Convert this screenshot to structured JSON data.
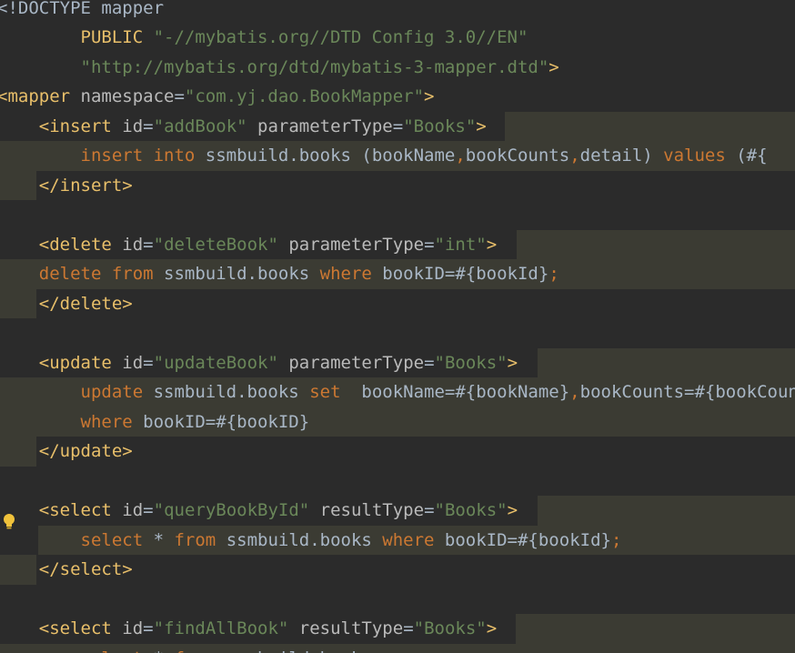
{
  "editor": {
    "lines": [
      {
        "tokens": [
          {
            "t": "plain",
            "v": "<!DOCTYPE mapper"
          }
        ]
      },
      {
        "tokens": [
          {
            "t": "plain",
            "v": "        "
          },
          {
            "t": "tag",
            "v": "PUBLIC "
          },
          {
            "t": "str",
            "v": "\"-//mybatis.org//DTD Config 3.0//EN\""
          }
        ]
      },
      {
        "tokens": [
          {
            "t": "plain",
            "v": "        "
          },
          {
            "t": "str",
            "v": "\"http://mybatis.org/dtd/mybatis-3-mapper.dtd\""
          },
          {
            "t": "tag",
            "v": ">"
          }
        ]
      },
      {
        "tokens": [
          {
            "t": "tag",
            "v": "<mapper "
          },
          {
            "t": "attr",
            "v": "namespace"
          },
          {
            "t": "eq",
            "v": "="
          },
          {
            "t": "str",
            "v": "\"com.yj.dao.BookMapper\""
          },
          {
            "t": "tag",
            "v": ">"
          }
        ]
      },
      {
        "tokens": [
          {
            "t": "plain",
            "v": "    "
          },
          {
            "t": "tag",
            "v": "<insert "
          },
          {
            "t": "attr",
            "v": "id"
          },
          {
            "t": "eq",
            "v": "="
          },
          {
            "t": "str",
            "v": "\"addBook\""
          },
          {
            "t": "plain",
            "v": " "
          },
          {
            "t": "attr",
            "v": "parameterType"
          },
          {
            "t": "eq",
            "v": "="
          },
          {
            "t": "str",
            "v": "\"Books\""
          },
          {
            "t": "tag",
            "v": ">"
          }
        ]
      },
      {
        "tokens": [
          {
            "t": "plain",
            "v": "        "
          },
          {
            "t": "kw",
            "v": "insert into "
          },
          {
            "t": "plain",
            "v": "ssmbuild.books (bookName"
          },
          {
            "t": "punct",
            "v": ","
          },
          {
            "t": "plain",
            "v": "bookCounts"
          },
          {
            "t": "punct",
            "v": ","
          },
          {
            "t": "plain",
            "v": "detail) "
          },
          {
            "t": "kw",
            "v": "values "
          },
          {
            "t": "plain",
            "v": "(#{"
          }
        ]
      },
      {
        "tokens": [
          {
            "t": "plain",
            "v": "    "
          },
          {
            "t": "tag",
            "v": "</insert>"
          }
        ]
      },
      {
        "tokens": []
      },
      {
        "tokens": [
          {
            "t": "plain",
            "v": "    "
          },
          {
            "t": "tag",
            "v": "<delete "
          },
          {
            "t": "attr",
            "v": "id"
          },
          {
            "t": "eq",
            "v": "="
          },
          {
            "t": "str",
            "v": "\"deleteBook\""
          },
          {
            "t": "plain",
            "v": " "
          },
          {
            "t": "attr",
            "v": "parameterType"
          },
          {
            "t": "eq",
            "v": "="
          },
          {
            "t": "str",
            "v": "\"int\""
          },
          {
            "t": "tag",
            "v": ">"
          }
        ]
      },
      {
        "tokens": [
          {
            "t": "plain",
            "v": "    "
          },
          {
            "t": "kw",
            "v": "delete from "
          },
          {
            "t": "plain",
            "v": "ssmbuild.books "
          },
          {
            "t": "kw",
            "v": "where "
          },
          {
            "t": "plain",
            "v": "bookID=#{bookId}"
          },
          {
            "t": "punct",
            "v": ";"
          }
        ]
      },
      {
        "tokens": [
          {
            "t": "plain",
            "v": "    "
          },
          {
            "t": "tag",
            "v": "</delete>"
          }
        ]
      },
      {
        "tokens": []
      },
      {
        "tokens": [
          {
            "t": "plain",
            "v": "    "
          },
          {
            "t": "tag",
            "v": "<update "
          },
          {
            "t": "attr",
            "v": "id"
          },
          {
            "t": "eq",
            "v": "="
          },
          {
            "t": "str",
            "v": "\"updateBook\""
          },
          {
            "t": "plain",
            "v": " "
          },
          {
            "t": "attr",
            "v": "parameterType"
          },
          {
            "t": "eq",
            "v": "="
          },
          {
            "t": "str",
            "v": "\"Books\""
          },
          {
            "t": "tag",
            "v": ">"
          }
        ]
      },
      {
        "tokens": [
          {
            "t": "plain",
            "v": "        "
          },
          {
            "t": "kw",
            "v": "update "
          },
          {
            "t": "plain",
            "v": "ssmbuild.books "
          },
          {
            "t": "kw",
            "v": "set  "
          },
          {
            "t": "plain",
            "v": "bookName=#{bookName}"
          },
          {
            "t": "punct",
            "v": ","
          },
          {
            "t": "plain",
            "v": "bookCounts=#{bookCounts}"
          }
        ]
      },
      {
        "tokens": [
          {
            "t": "plain",
            "v": "        "
          },
          {
            "t": "kw",
            "v": "where "
          },
          {
            "t": "plain",
            "v": "bookID=#{bookID}"
          }
        ]
      },
      {
        "tokens": [
          {
            "t": "plain",
            "v": "    "
          },
          {
            "t": "tag",
            "v": "</update>"
          }
        ]
      },
      {
        "tokens": []
      },
      {
        "tokens": [
          {
            "t": "plain",
            "v": "    "
          },
          {
            "t": "tag",
            "v": "<select "
          },
          {
            "t": "attr",
            "v": "id"
          },
          {
            "t": "eq",
            "v": "="
          },
          {
            "t": "str",
            "v": "\"queryBookById\""
          },
          {
            "t": "plain",
            "v": " "
          },
          {
            "t": "attr",
            "v": "resultType"
          },
          {
            "t": "eq",
            "v": "="
          },
          {
            "t": "str",
            "v": "\"Books\""
          },
          {
            "t": "tag",
            "v": ">"
          }
        ]
      },
      {
        "tokens": [
          {
            "t": "plain",
            "v": "        "
          },
          {
            "t": "kw",
            "v": "select "
          },
          {
            "t": "plain",
            "v": "* "
          },
          {
            "t": "kw",
            "v": "from "
          },
          {
            "t": "plain",
            "v": "ssmbuild.books "
          },
          {
            "t": "kw",
            "v": "where "
          },
          {
            "t": "plain",
            "v": "bookID=#{bookId}"
          },
          {
            "t": "punct",
            "v": ";"
          }
        ]
      },
      {
        "tokens": [
          {
            "t": "plain",
            "v": "    "
          },
          {
            "t": "tag",
            "v": "</select>"
          }
        ]
      },
      {
        "tokens": []
      },
      {
        "tokens": [
          {
            "t": "plain",
            "v": "    "
          },
          {
            "t": "tag",
            "v": "<select "
          },
          {
            "t": "attr",
            "v": "id"
          },
          {
            "t": "eq",
            "v": "="
          },
          {
            "t": "str",
            "v": "\"findAllBook\""
          },
          {
            "t": "plain",
            "v": " "
          },
          {
            "t": "attr",
            "v": "resultType"
          },
          {
            "t": "eq",
            "v": "="
          },
          {
            "t": "str",
            "v": "\"Books\""
          },
          {
            "t": "tag",
            "v": ">"
          }
        ]
      },
      {
        "tokens": [
          {
            "t": "plain",
            "v": "        "
          },
          {
            "t": "kw",
            "v": "select "
          },
          {
            "t": "plain",
            "v": "* "
          },
          {
            "t": "kw",
            "v": "from "
          },
          {
            "t": "plain",
            "v": "ssmbuild.books"
          },
          {
            "t": "punct",
            "v": ";"
          }
        ]
      }
    ],
    "gutter_icon": "lightbulb-icon"
  },
  "colors": {
    "background": "#2b2b2b",
    "injected_highlight": "#3b3b33",
    "tag": "#e8bf6a",
    "string": "#6a8759",
    "keyword": "#cc7832",
    "plain": "#a9b7c6",
    "bulb": "#f0c23b"
  }
}
